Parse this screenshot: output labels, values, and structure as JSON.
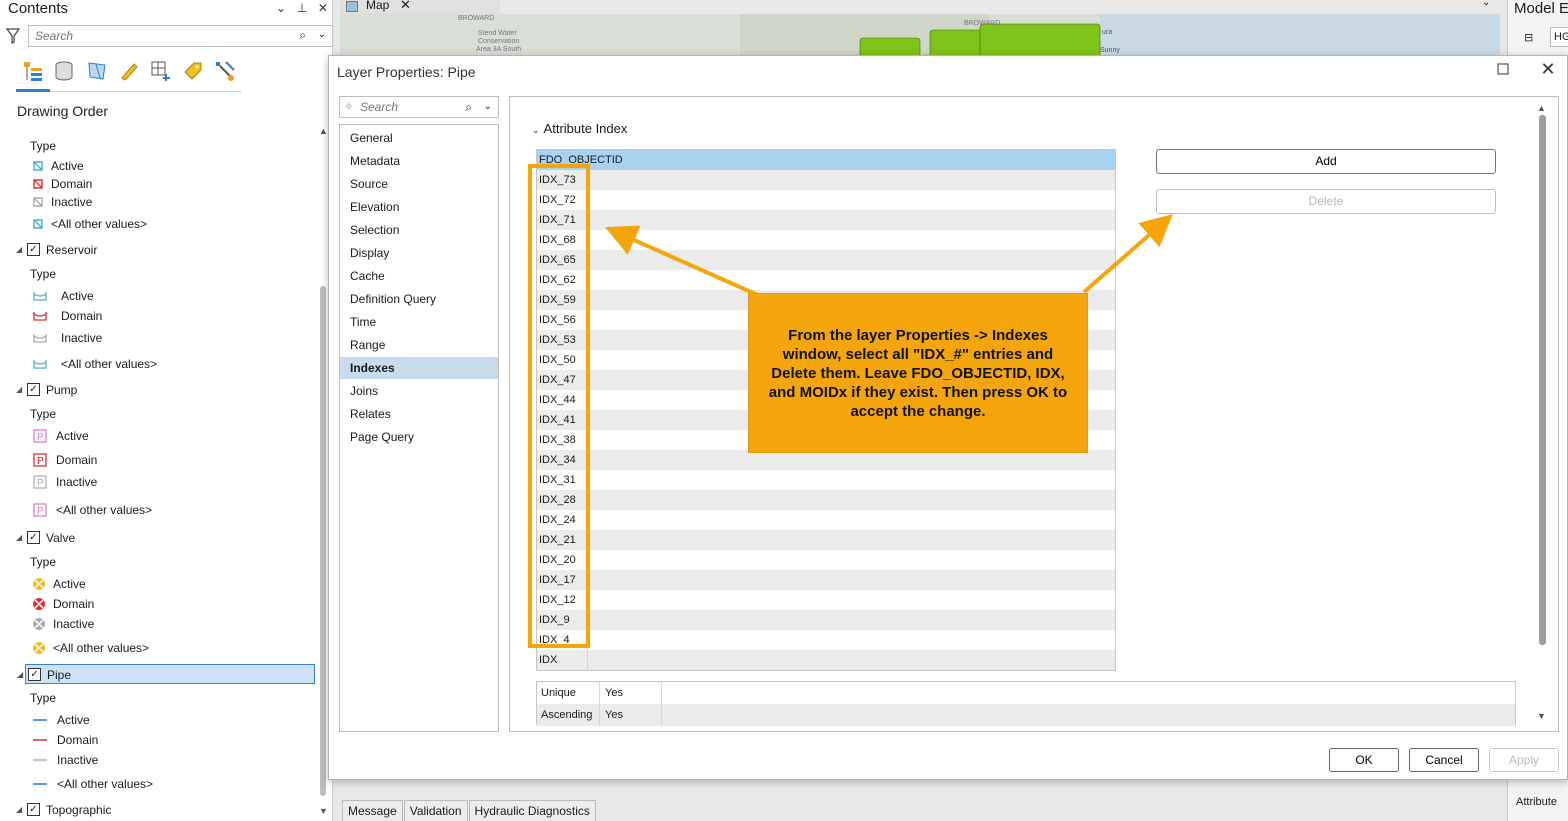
{
  "contents": {
    "title": "Contents",
    "search_placeholder": "Search",
    "drawing_order": "Drawing Order",
    "items": [
      {
        "kind": "type",
        "label": "Type"
      },
      {
        "kind": "sym",
        "label": "Active"
      },
      {
        "kind": "sym",
        "label": "Domain"
      },
      {
        "kind": "sym",
        "label": "Inactive"
      },
      {
        "kind": "sym",
        "label": "<All other values>"
      },
      {
        "kind": "layer",
        "label": "Reservoir"
      },
      {
        "kind": "type",
        "label": "Type"
      },
      {
        "kind": "sym",
        "label": "Active"
      },
      {
        "kind": "sym",
        "label": "Domain"
      },
      {
        "kind": "sym",
        "label": "Inactive"
      },
      {
        "kind": "sym",
        "label": "<All other values>"
      },
      {
        "kind": "layer",
        "label": "Pump"
      },
      {
        "kind": "type",
        "label": "Type"
      },
      {
        "kind": "sym",
        "label": "Active"
      },
      {
        "kind": "sym",
        "label": "Domain"
      },
      {
        "kind": "sym",
        "label": "Inactive"
      },
      {
        "kind": "sym",
        "label": "<All other values>"
      },
      {
        "kind": "layer",
        "label": "Valve"
      },
      {
        "kind": "type",
        "label": "Type"
      },
      {
        "kind": "sym",
        "label": "Active"
      },
      {
        "kind": "sym",
        "label": "Domain"
      },
      {
        "kind": "sym",
        "label": "Inactive"
      },
      {
        "kind": "sym",
        "label": "<All other values>"
      },
      {
        "kind": "layer",
        "label": "Pipe",
        "selected": true
      },
      {
        "kind": "type",
        "label": "Type"
      },
      {
        "kind": "sym",
        "label": "Active"
      },
      {
        "kind": "sym",
        "label": "Domain"
      },
      {
        "kind": "sym",
        "label": "Inactive"
      },
      {
        "kind": "sym",
        "label": "<All other values>"
      },
      {
        "kind": "layer",
        "label": "Topographic"
      }
    ]
  },
  "map": {
    "tab_label": "Map",
    "labels": [
      "BROWARD",
      "Stend Water",
      "Conservation",
      "Area 3A South",
      "BROWARD",
      "ura",
      "Sunny"
    ]
  },
  "model_pane": {
    "title": "Model E",
    "field": "HG",
    "attribute": "Attribute"
  },
  "bottom_tabs": [
    "Message",
    "Validation",
    "Hydraulic Diagnostics"
  ],
  "dialog": {
    "title": "Layer Properties: Pipe",
    "search_placeholder": "Search",
    "nav": [
      "General",
      "Metadata",
      "Source",
      "Elevation",
      "Selection",
      "Display",
      "Cache",
      "Definition Query",
      "Time",
      "Range",
      "Indexes",
      "Joins",
      "Relates",
      "Page Query"
    ],
    "nav_selected": "Indexes",
    "section_title": "Attribute Index",
    "indexes": [
      "FDO_OBJECTID",
      "IDX_73",
      "IDX_72",
      "IDX_71",
      "IDX_68",
      "IDX_65",
      "IDX_62",
      "IDX_59",
      "IDX_56",
      "IDX_53",
      "IDX_50",
      "IDX_47",
      "IDX_44",
      "IDX_41",
      "IDX_38",
      "IDX_34",
      "IDX_31",
      "IDX_28",
      "IDX_24",
      "IDX_21",
      "IDX_20",
      "IDX_17",
      "IDX_12",
      "IDX_9",
      "IDX_4",
      "IDX"
    ],
    "selected_index": "FDO_OBJECTID",
    "add_label": "Add",
    "delete_label": "Delete",
    "properties": [
      {
        "key": "Unique",
        "value": "Yes"
      },
      {
        "key": "Ascending",
        "value": "Yes"
      }
    ],
    "ok_label": "OK",
    "cancel_label": "Cancel",
    "apply_label": "Apply"
  },
  "annotation": {
    "text": "From the layer Properties -> Indexes window, select all \"IDX_#\" entries and Delete them. Leave FDO_OBJECTID, IDX, and MOIDx if they exist. Then press OK to accept the change.",
    "color": "#f5a50c"
  }
}
